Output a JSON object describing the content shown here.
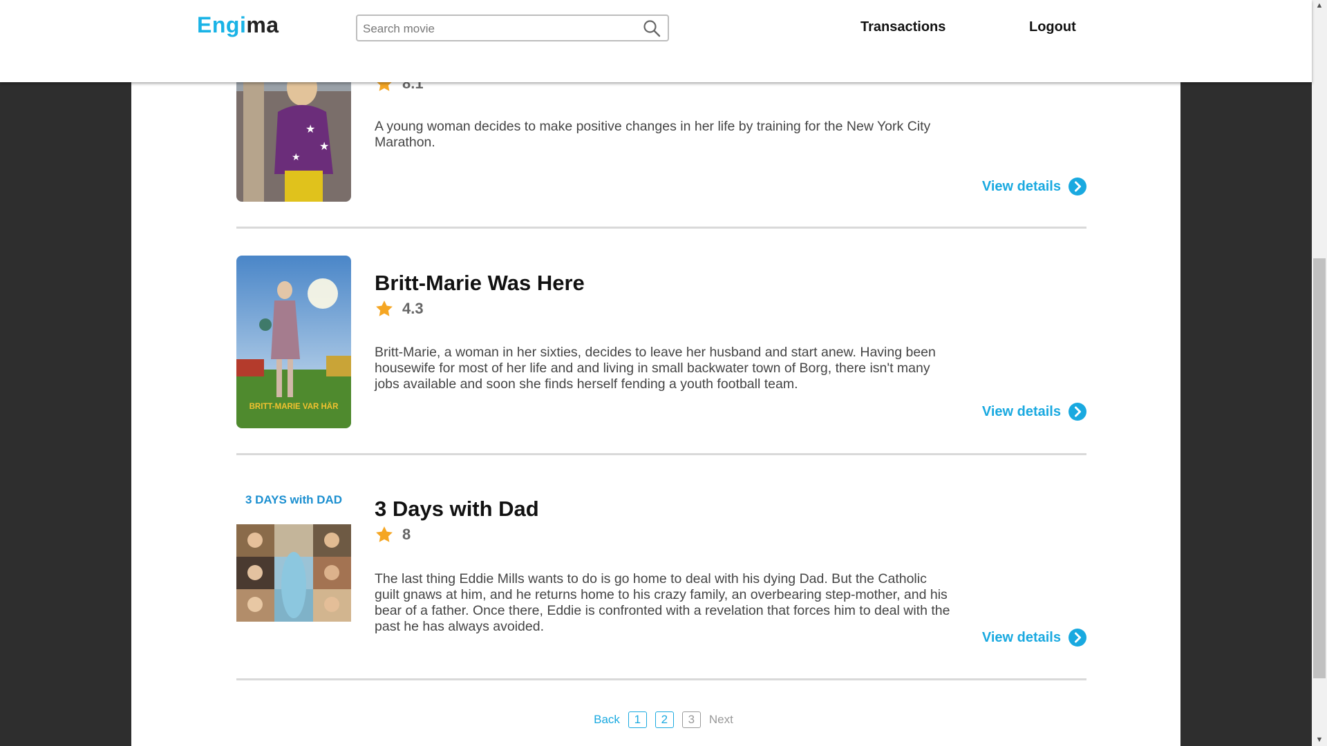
{
  "header": {
    "logo_part1": "Engi",
    "logo_part2": "ma",
    "search_placeholder": "Search movie",
    "nav": {
      "transactions": "Transactions",
      "logout": "Logout"
    }
  },
  "movies": [
    {
      "title": "",
      "rating": "8.1",
      "description": "A young woman decides to make positive changes in her life by training for the New York City Marathon.",
      "details_label": "View details"
    },
    {
      "title": "Britt-Marie Was Here",
      "rating": "4.3",
      "description": "Britt-Marie, a woman in her sixties, decides to leave her husband and start anew. Having been housewife for most of her life and and living in small backwater town of Borg, there isn't many jobs available and soon she finds herself fending a youth football team.",
      "details_label": "View details",
      "poster_text": "BRITT-MARIE VAR HÄR"
    },
    {
      "title": "3 Days with Dad",
      "rating": "8",
      "description": "The last thing Eddie Mills wants to do is go home to deal with his dying Dad. But the Catholic guilt gnaws at him, and he returns home to his crazy family, an overbearing step-mother, and his bear of a father. Once there, Eddie is confronted with a revelation that forces him to deal with the past he has always avoided.",
      "details_label": "View details",
      "poster_text": "3 DAYS with DAD"
    }
  ],
  "pagination": {
    "back": "Back",
    "pages": [
      "1",
      "2",
      "3"
    ],
    "next": "Next"
  },
  "colors": {
    "accent": "#19a9e0",
    "star": "#f5a623",
    "background": "#2e2e2e"
  }
}
